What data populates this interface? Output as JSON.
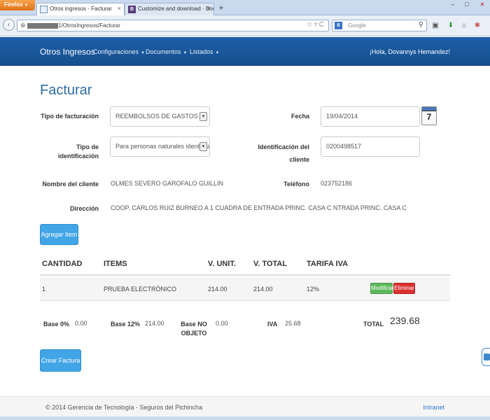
{
  "browser": {
    "menu_button": "Firefox",
    "tabs": [
      {
        "title": "Otros ingresos - Facturar"
      },
      {
        "title": "Customize and download · Bootstrap",
        "favicon": "B"
      }
    ],
    "new_tab": "+",
    "url": "1/OtrosIngresos/Facturar",
    "search_placeholder": "Google",
    "search_engine_letter": "8"
  },
  "app": {
    "brand": "Otros Ingresos",
    "menu": [
      "Configuraciones",
      "Documentos",
      "Listados"
    ],
    "greeting": "¡Hola, Dovannys Hemandez!"
  },
  "form": {
    "title": "Facturar",
    "tipo_facturacion_label": "Tipo de facturación",
    "tipo_facturacion_value": "REEMBOLSOS DE GASTOS",
    "fecha_label": "Fecha",
    "fecha_value": "19/04/2014",
    "calendar_day": "7",
    "tipo_identificacion_label": "Tipo de identificación",
    "tipo_identificacion_value": "Para personas naturales identificada",
    "identificacion_label_1": "Identificación del",
    "identificacion_label_2": "cliente",
    "identificacion_value": "0200498517",
    "nombre_label": "Nombre del cliente",
    "nombre_value": "OLMES SEVERO GAROFALO GUILLIN",
    "telefono_label": "Teléfono",
    "telefono_value": "023752186",
    "direccion_label": "Dirección",
    "direccion_value": "COOP. CARLOS RUIZ BURNEO A 1 CUADRA DE ENTRADA PRINC. CASA C NTRADA PRINC. CASA C",
    "agregar_button": "Agregar Item"
  },
  "table": {
    "headers": [
      "CANTIDAD",
      "ITEMS",
      "V. UNIT.",
      "V. TOTAL",
      "TARIFA IVA"
    ],
    "rows": [
      {
        "cantidad": "1",
        "item": "PRUEBA ELECTRÓNICO",
        "v_unit": "214.00",
        "v_total": "214.00",
        "tarifa": "12%",
        "modificar": "Modificar",
        "eliminar": "Eliminar"
      }
    ]
  },
  "totals": {
    "base0_label": "Base 0%",
    "base0_value": "0.00",
    "base12_label": "Base 12%",
    "base12_value": "214.00",
    "base_no_label_1": "Base NO",
    "base_no_label_2": "OBJETO",
    "base_no_value": "0.00",
    "iva_label": "IVA",
    "iva_value": "25.68",
    "total_label": "TOTAL",
    "total_value": "239.68"
  },
  "crear_button": "Crear Factura",
  "footer": {
    "copyright": "© 2014 Gerencia de Tecnología - Seguros del Pichincha",
    "link": "Intranet"
  }
}
